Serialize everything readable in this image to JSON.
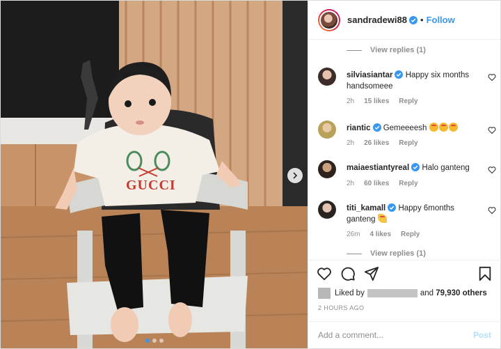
{
  "header": {
    "username": "sandradewi88",
    "separator": "•",
    "follow_label": "Follow"
  },
  "comments": {
    "view_replies_top": "View replies (1)",
    "view_replies_bottom": "View replies (1)",
    "items": [
      {
        "username": "silviasiantar",
        "text": "Happy six months handsomeee",
        "time": "2h",
        "likes": "15 likes",
        "reply": "Reply"
      },
      {
        "username": "riantic",
        "text": "Gemeeeesh",
        "emoji": "heart-eyes-emoji x3",
        "time": "2h",
        "likes": "26 likes",
        "reply": "Reply"
      },
      {
        "username": "maiaestiantyreal",
        "text": "Halo ganteng",
        "time": "2h",
        "likes": "60 likes",
        "reply": "Reply"
      },
      {
        "username": "titi_kamall",
        "text": "Happy 6months ganteng",
        "emoji": "party-popper-emoji",
        "time": "26m",
        "likes": "4 likes",
        "reply": "Reply"
      }
    ]
  },
  "likes": {
    "prefix": "Liked by",
    "connector": "and",
    "count": "79,930 others"
  },
  "timestamp": "2 HOURS AGO",
  "add_comment": {
    "placeholder": "Add a comment...",
    "post_label": "Post"
  },
  "photo": {
    "shirt_text": "GUCCI",
    "carousel_total": 3,
    "carousel_active": 1
  },
  "colors": {
    "accent": "#3897f0",
    "muted": "#8e8e8e",
    "post_disabled": "#b2dffc"
  }
}
